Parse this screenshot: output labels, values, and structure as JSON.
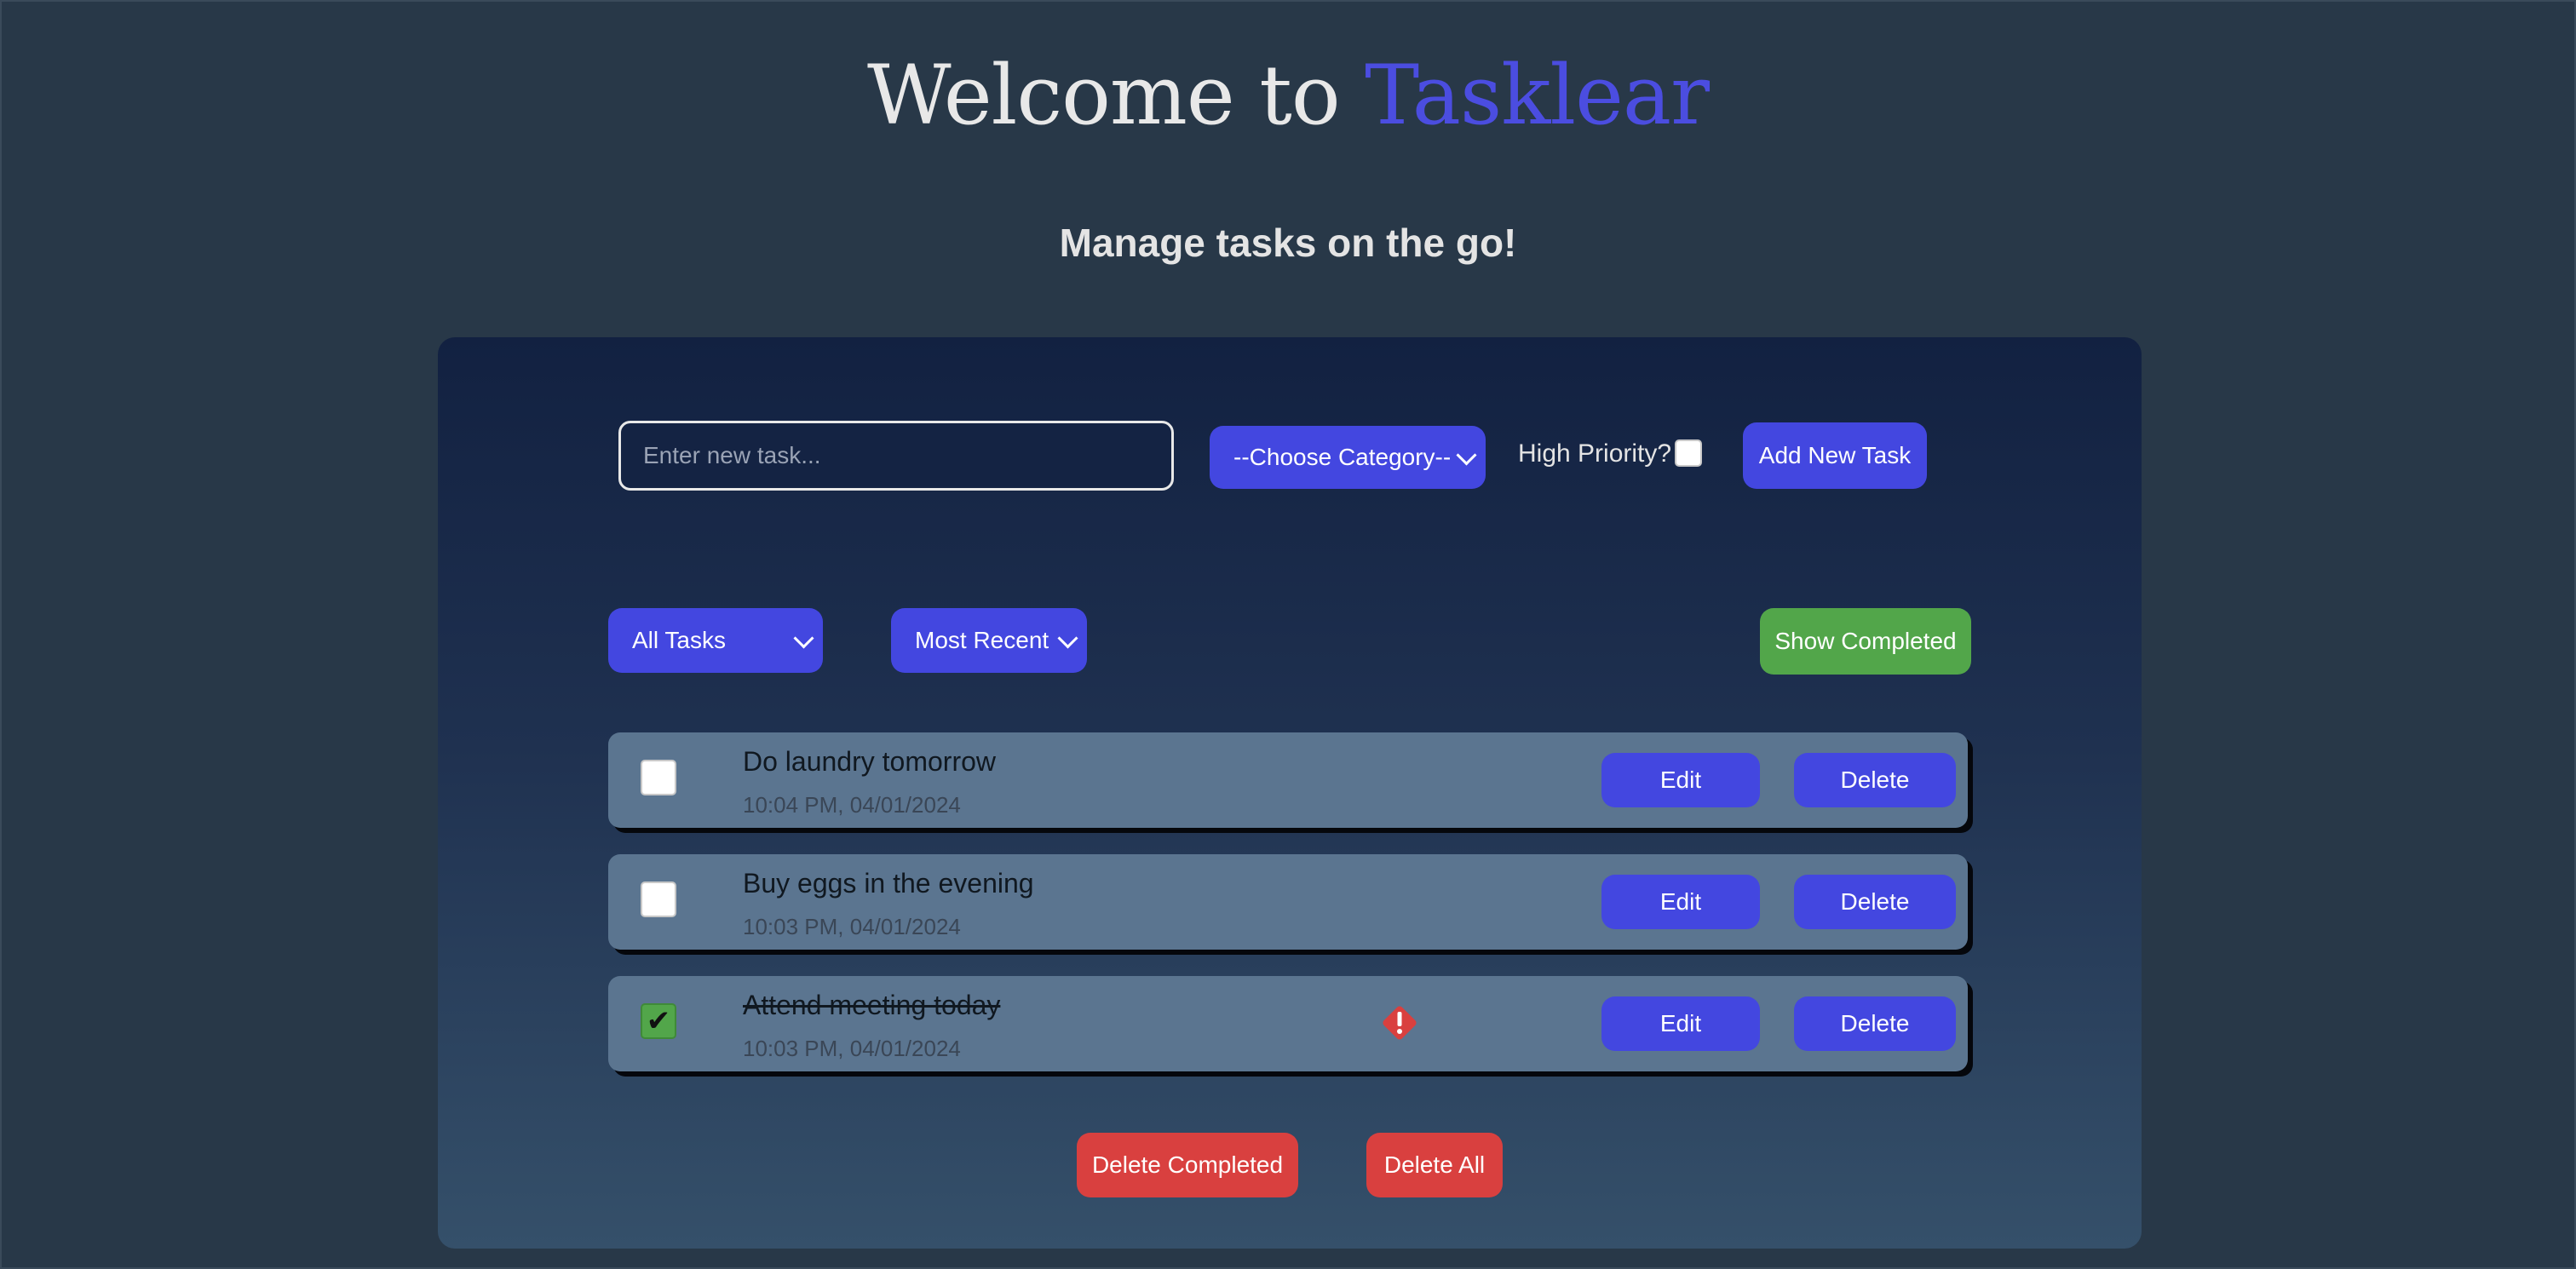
{
  "header": {
    "title_prefix": "Welcome to",
    "title_brand": "Tasklear",
    "subtitle": "Manage tasks on the go!"
  },
  "form": {
    "task_placeholder": "Enter new task...",
    "category_selected": "--Choose Category--",
    "priority_label": "High Priority?",
    "priority_checked": false,
    "add_label": "Add New Task"
  },
  "controls": {
    "filter_selected": "All Tasks",
    "sort_selected": "Most Recent",
    "show_completed_label": "Show Completed"
  },
  "tasks": [
    {
      "text": "Do laundry tomorrow",
      "time": "10:04 PM, 04/01/2024",
      "completed": false,
      "high_priority": false,
      "edit_label": "Edit",
      "delete_label": "Delete"
    },
    {
      "text": "Buy eggs in the evening",
      "time": "10:03 PM, 04/01/2024",
      "completed": false,
      "high_priority": false,
      "edit_label": "Edit",
      "delete_label": "Delete"
    },
    {
      "text": "Attend meeting today",
      "time": "10:03 PM, 04/01/2024",
      "completed": true,
      "high_priority": true,
      "edit_label": "Edit",
      "delete_label": "Delete"
    }
  ],
  "footer": {
    "delete_completed_label": "Delete Completed",
    "delete_all_label": "Delete All"
  },
  "colors": {
    "background": "#283848",
    "accent": "#4347e0",
    "success": "#52a64a",
    "danger": "#d9403f",
    "task_row": "#5b7590"
  }
}
